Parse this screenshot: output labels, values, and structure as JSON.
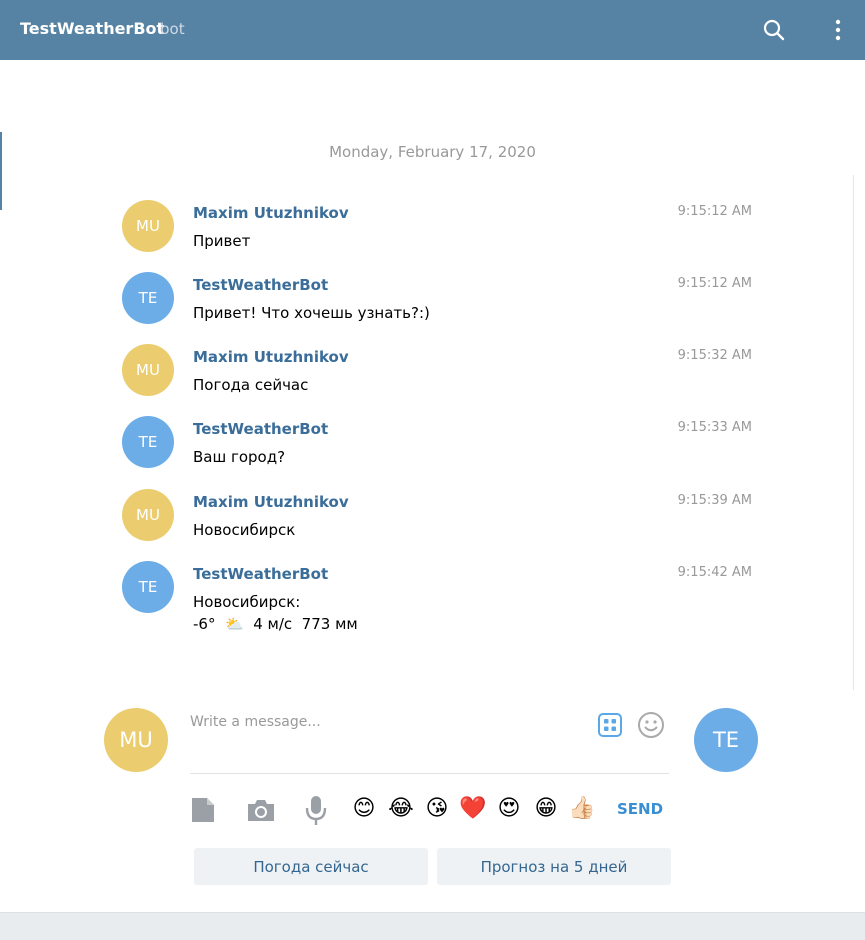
{
  "header": {
    "title": "TestWeatherBot",
    "subtitle": "bot",
    "background": "#5682a3"
  },
  "date_separator": "Monday, February 17, 2020",
  "messages": [
    {
      "avatar": "MU",
      "avatar_color": "#ebcc6e",
      "name": "Maxim Utuzhnikov",
      "time": "9:15:12 AM",
      "text": "Привет"
    },
    {
      "avatar": "TE",
      "avatar_color": "#6cade8",
      "name": "TestWeatherBot",
      "time": "9:15:12 AM",
      "text": "Привет! Что хочешь узнать?:)"
    },
    {
      "avatar": "MU",
      "avatar_color": "#ebcc6e",
      "name": "Maxim Utuzhnikov",
      "time": "9:15:32 AM",
      "text": "Погода сейчас"
    },
    {
      "avatar": "TE",
      "avatar_color": "#6cade8",
      "name": "TestWeatherBot",
      "time": "9:15:33 AM",
      "text": "Ваш город?"
    },
    {
      "avatar": "MU",
      "avatar_color": "#ebcc6e",
      "name": "Maxim Utuzhnikov",
      "time": "9:15:39 AM",
      "text": "Новосибирск"
    },
    {
      "avatar": "TE",
      "avatar_color": "#6cade8",
      "name": "TestWeatherBot",
      "time": "9:15:42 AM",
      "text": "Новосибирск:\n-6°  ⛅  4 м/с  773 мм"
    }
  ],
  "compose": {
    "placeholder": "Write a message...",
    "self_avatar": "MU",
    "peer_avatar": "TE",
    "send_label": "SEND"
  },
  "emoji_bar": [
    "😊",
    "😂",
    "😘",
    "❤️",
    "😍",
    "😁",
    "👍🏻"
  ],
  "keyboard_buttons": [
    "Погода сейчас",
    "Прогноз на 5 дней"
  ]
}
